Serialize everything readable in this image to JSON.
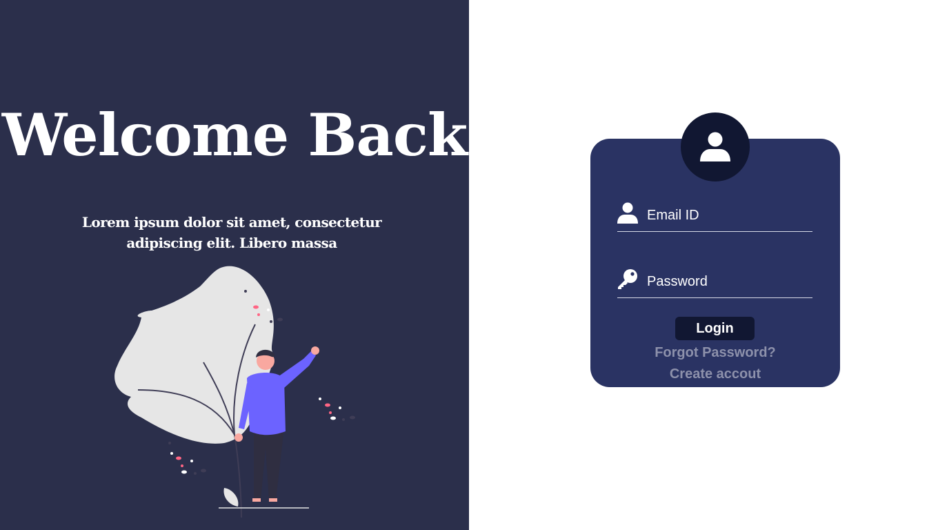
{
  "hero": {
    "title": "Welcome Back",
    "subtitle": "Lorem ipsum dolor sit amet, consectetur adipiscing elit. Libero massa"
  },
  "login": {
    "avatar_icon": "user-icon",
    "email": {
      "placeholder": "Email ID",
      "value": "",
      "icon": "user-icon"
    },
    "password": {
      "placeholder": "Password",
      "value": "",
      "icon": "key-icon"
    },
    "button_label": "Login",
    "forgot_label": "Forgot Password?",
    "create_label": "Create accout"
  },
  "colors": {
    "left_bg": "#2b2f4b",
    "card_bg": "#2a3363",
    "dark_accent": "#111732",
    "link_muted": "#8d91ab",
    "figure_shirt": "#6c63ff",
    "leaf": "#e6e6e6",
    "accent_pink": "#ff6584"
  }
}
